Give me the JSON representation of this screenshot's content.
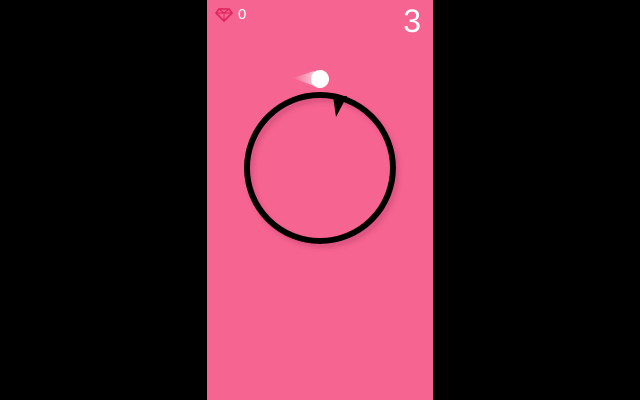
{
  "hud": {
    "gem_count": "0",
    "gem_icon": "ruby-gem-icon",
    "score": "3"
  },
  "colors": {
    "outside_background": "#000000",
    "playfield_background": "#f66491",
    "ring": "#000000",
    "ball": "#ffffff",
    "trail": "#ffffff",
    "gem": "#e0245e",
    "hud_text": "#ffffff"
  }
}
